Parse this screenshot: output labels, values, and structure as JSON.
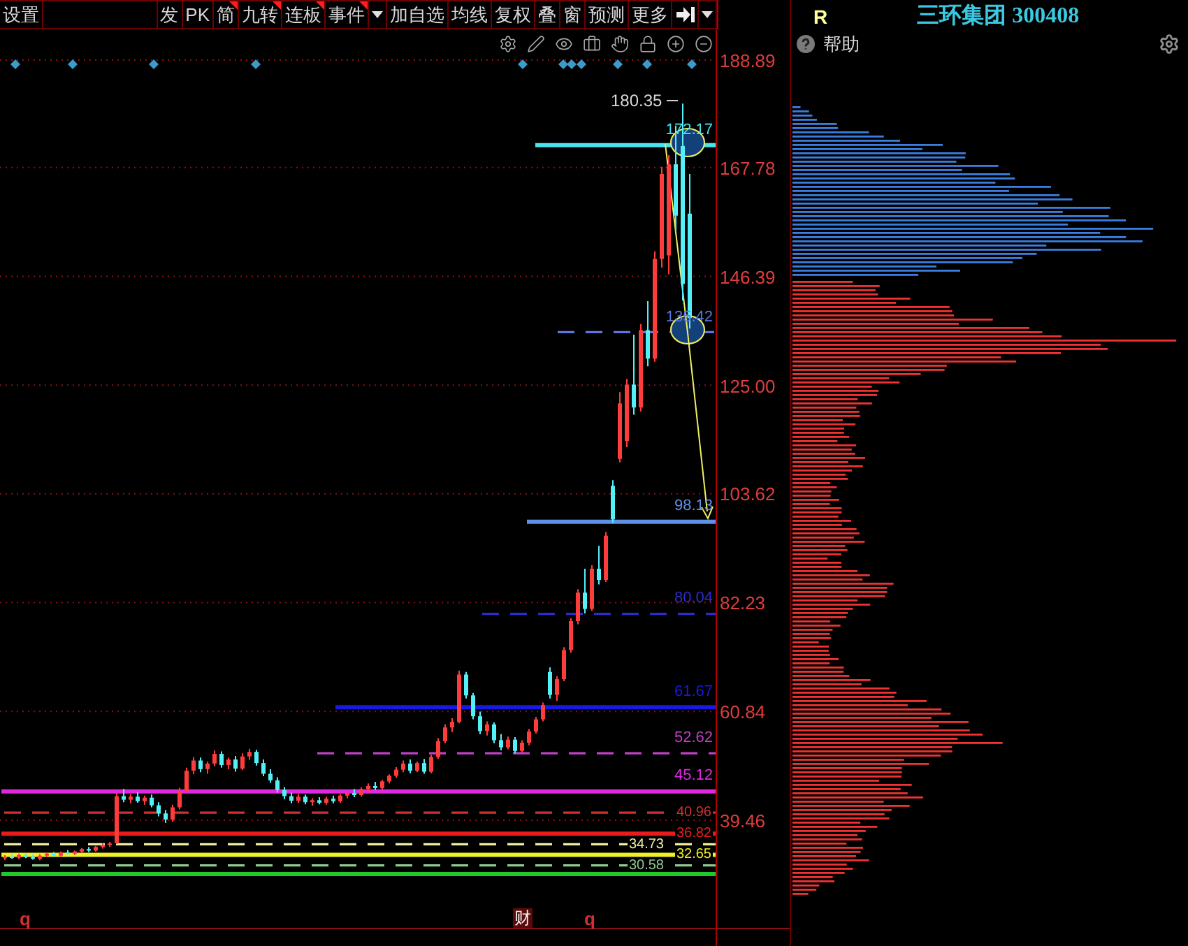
{
  "toolbar": {
    "settings": "设置",
    "buttons": [
      {
        "kind": "text",
        "label": "发",
        "new_mark": false
      },
      {
        "kind": "text",
        "label": "PK",
        "new_mark": false
      },
      {
        "kind": "text",
        "label": "简",
        "new_mark": true
      },
      {
        "kind": "text",
        "label": "九转",
        "new_mark": true
      },
      {
        "kind": "text",
        "label": "连板",
        "new_mark": true
      },
      {
        "kind": "text",
        "label": "事件",
        "new_mark": true
      },
      {
        "kind": "caret"
      },
      {
        "kind": "text",
        "label": "加自选",
        "new_mark": false
      },
      {
        "kind": "text",
        "label": "均线",
        "new_mark": false
      },
      {
        "kind": "text",
        "label": "复权",
        "new_mark": false
      },
      {
        "kind": "text",
        "label": "叠",
        "new_mark": false
      },
      {
        "kind": "text",
        "label": "窗",
        "new_mark": false
      },
      {
        "kind": "text",
        "label": "预测",
        "new_mark": false
      },
      {
        "kind": "text",
        "label": "更多",
        "new_mark": false
      },
      {
        "kind": "collapse"
      },
      {
        "kind": "caret"
      }
    ]
  },
  "chart": {
    "high_label": "180.35",
    "chart_data": {
      "type": "candlestick",
      "grid": true,
      "ohlc": [
        [
          32.0,
          32.6,
          31.6,
          32.3
        ],
        [
          32.3,
          32.8,
          31.9,
          32.1
        ],
        [
          32.1,
          32.9,
          31.8,
          32.6
        ],
        [
          32.6,
          33.0,
          32.0,
          32.2
        ],
        [
          32.2,
          32.7,
          31.7,
          31.9
        ],
        [
          31.9,
          32.8,
          31.6,
          32.5
        ],
        [
          32.5,
          33.1,
          32.2,
          32.9
        ],
        [
          32.9,
          33.2,
          32.3,
          32.5
        ],
        [
          32.5,
          33.3,
          32.3,
          33.1
        ],
        [
          33.1,
          33.6,
          32.7,
          32.9
        ],
        [
          32.9,
          33.5,
          32.6,
          33.3
        ],
        [
          33.3,
          34.0,
          33.0,
          33.8
        ],
        [
          33.8,
          34.2,
          33.2,
          33.5
        ],
        [
          33.5,
          34.4,
          33.3,
          34.2
        ],
        [
          34.2,
          34.9,
          33.9,
          34.6
        ],
        [
          34.6,
          35.2,
          34.2,
          34.9
        ],
        [
          35.0,
          44.8,
          34.8,
          44.2
        ],
        [
          44.2,
          45.6,
          43.0,
          43.5
        ],
        [
          43.5,
          44.6,
          42.8,
          44.1
        ],
        [
          44.1,
          45.0,
          42.9,
          43.2
        ],
        [
          43.2,
          44.3,
          42.5,
          43.9
        ],
        [
          43.9,
          44.5,
          42.0,
          42.4
        ],
        [
          42.4,
          43.0,
          40.2,
          40.8
        ],
        [
          40.8,
          41.5,
          38.9,
          39.6
        ],
        [
          39.6,
          42.5,
          39.2,
          42.0
        ],
        [
          42.0,
          45.8,
          41.6,
          45.3
        ],
        [
          45.3,
          49.8,
          45.0,
          49.2
        ],
        [
          49.2,
          51.9,
          48.5,
          51.2
        ],
        [
          51.2,
          51.8,
          48.9,
          49.5
        ],
        [
          49.5,
          51.0,
          48.6,
          50.6
        ],
        [
          50.6,
          53.2,
          50.1,
          52.5
        ],
        [
          52.5,
          53.0,
          49.8,
          50.3
        ],
        [
          50.3,
          51.8,
          49.5,
          51.4
        ],
        [
          51.4,
          52.1,
          49.0,
          49.6
        ],
        [
          49.6,
          52.6,
          49.3,
          52.0
        ],
        [
          52.0,
          53.5,
          51.3,
          52.9
        ],
        [
          52.9,
          53.3,
          50.2,
          50.7
        ],
        [
          50.7,
          51.4,
          48.1,
          48.6
        ],
        [
          48.6,
          49.5,
          46.8,
          47.3
        ],
        [
          47.3,
          47.9,
          44.9,
          45.4
        ],
        [
          45.4,
          46.0,
          43.6,
          44.2
        ],
        [
          44.2,
          44.9,
          42.8,
          43.3
        ],
        [
          43.3,
          44.6,
          42.9,
          44.1
        ],
        [
          44.1,
          44.5,
          42.6,
          43.0
        ],
        [
          43.0,
          43.8,
          42.3,
          43.4
        ],
        [
          43.4,
          44.0,
          42.6,
          42.9
        ],
        [
          42.9,
          44.1,
          42.5,
          43.7
        ],
        [
          43.7,
          44.3,
          42.8,
          43.2
        ],
        [
          43.2,
          44.6,
          42.9,
          44.3
        ],
        [
          44.3,
          45.2,
          43.8,
          44.8
        ],
        [
          44.8,
          45.6,
          44.0,
          44.4
        ],
        [
          44.4,
          45.9,
          44.1,
          45.6
        ],
        [
          45.6,
          46.7,
          45.1,
          46.2
        ],
        [
          46.2,
          47.0,
          45.4,
          45.8
        ],
        [
          45.8,
          47.4,
          45.5,
          47.1
        ],
        [
          47.1,
          48.5,
          46.7,
          48.2
        ],
        [
          48.2,
          49.9,
          47.8,
          49.4
        ],
        [
          49.4,
          51.2,
          48.9,
          50.6
        ],
        [
          50.6,
          51.4,
          48.7,
          49.2
        ],
        [
          49.2,
          51.0,
          48.9,
          50.7
        ],
        [
          50.7,
          51.5,
          48.6,
          49.0
        ],
        [
          49.0,
          52.3,
          48.7,
          51.9
        ],
        [
          51.9,
          55.6,
          51.5,
          55.0
        ],
        [
          55.0,
          58.3,
          54.6,
          57.7
        ],
        [
          57.7,
          59.5,
          56.8,
          58.8
        ],
        [
          58.8,
          68.9,
          58.5,
          68.1
        ],
        [
          68.1,
          68.6,
          63.4,
          64.0
        ],
        [
          64.0,
          64.5,
          59.3,
          59.9
        ],
        [
          59.9,
          60.8,
          56.4,
          57.0
        ],
        [
          57.0,
          58.9,
          56.1,
          58.3
        ],
        [
          58.3,
          58.7,
          54.6,
          55.2
        ],
        [
          55.2,
          56.4,
          53.2,
          53.8
        ],
        [
          53.8,
          55.9,
          53.4,
          55.3
        ],
        [
          55.3,
          55.8,
          52.6,
          53.1
        ],
        [
          53.1,
          55.2,
          52.8,
          54.7
        ],
        [
          54.7,
          57.4,
          54.2,
          56.9
        ],
        [
          56.9,
          59.8,
          56.5,
          59.3
        ],
        [
          59.3,
          62.6,
          58.9,
          62.1
        ],
        [
          68.6,
          69.5,
          63.4,
          64.1
        ],
        [
          64.1,
          67.8,
          62.9,
          67.2
        ],
        [
          67.2,
          73.5,
          66.8,
          72.9
        ],
        [
          72.9,
          79.2,
          72.4,
          78.6
        ],
        [
          78.6,
          84.9,
          78.0,
          84.2
        ],
        [
          84.2,
          88.9,
          80.1,
          81.0
        ],
        [
          81.0,
          89.6,
          80.6,
          88.9
        ],
        [
          88.9,
          93.4,
          85.8,
          86.7
        ],
        [
          86.7,
          96.1,
          86.3,
          95.4
        ],
        [
          105.2,
          106.3,
          97.9,
          98.6
        ],
        [
          110.5,
          123.6,
          109.8,
          121.4
        ],
        [
          114.0,
          126.2,
          112.8,
          125.1
        ],
        [
          125.1,
          134.9,
          119.2,
          120.6
        ],
        [
          120.6,
          137.0,
          119.8,
          135.8
        ],
        [
          135.8,
          141.5,
          128.7,
          130.2
        ],
        [
          130.2,
          151.3,
          129.6,
          149.8
        ],
        [
          149.8,
          167.9,
          148.1,
          166.5
        ],
        [
          150.5,
          170.2,
          146.8,
          168.4
        ],
        [
          168.4,
          176.0,
          155.2,
          158.3
        ],
        [
          172.0,
          180.35,
          141.6,
          144.9
        ],
        [
          158.7,
          166.5,
          136.1,
          138.2
        ]
      ],
      "ylim": [
        18.31,
        194.93
      ],
      "yticks": [
        {
          "value": 188.89,
          "label": "188.89"
        },
        {
          "value": 167.78,
          "label": "167.78"
        },
        {
          "value": 146.39,
          "label": "146.39"
        },
        {
          "value": 125.0,
          "label": "125.00"
        },
        {
          "value": 103.62,
          "label": "103.62"
        },
        {
          "value": 82.23,
          "label": "82.23"
        },
        {
          "value": 60.84,
          "label": "60.84"
        },
        {
          "value": 39.46,
          "label": "39.46"
        }
      ],
      "ref_lines": [
        {
          "axis": "y",
          "value": 172.17,
          "label": "172.17",
          "color": "#48e4f0"
        },
        {
          "axis": "y",
          "value": 135.42,
          "label": "135.42",
          "color": "#5a78e0"
        },
        {
          "axis": "y",
          "value": 98.13,
          "label": "98.13",
          "color": "#6090e8"
        },
        {
          "axis": "y",
          "value": 80.04,
          "label": "80.04",
          "color": "#2c2cd0"
        },
        {
          "axis": "y",
          "value": 61.67,
          "label": "61.67",
          "color": "#1818e8"
        },
        {
          "axis": "y",
          "value": 52.62,
          "label": "52.62",
          "color": "#c040c8"
        },
        {
          "axis": "y",
          "value": 45.12,
          "label": "45.12",
          "color": "#e028e0"
        },
        {
          "axis": "y",
          "value": 40.96,
          "label": "40.96",
          "color": "#d03030"
        },
        {
          "axis": "y",
          "value": 36.82,
          "label": "36.82",
          "color": "#e81c1c"
        },
        {
          "axis": "y",
          "value": 34.73,
          "label": "34.73",
          "color": "#f0f0a0"
        },
        {
          "axis": "y",
          "value": 32.65,
          "label": "32.65",
          "color": "#f0f028"
        },
        {
          "axis": "y",
          "value": 30.58,
          "label": "30.58",
          "color": "#90c890"
        },
        {
          "axis": "y",
          "value": 28.9,
          "color": "#20c828"
        }
      ]
    },
    "markers": [
      {
        "kind": "plain",
        "label": "q"
      },
      {
        "kind": "boxed",
        "label": "财"
      },
      {
        "kind": "plain",
        "label": "q"
      }
    ]
  },
  "side_panel": {
    "corner_label": "R",
    "title": "三环集团 300408",
    "help": "帮助"
  }
}
